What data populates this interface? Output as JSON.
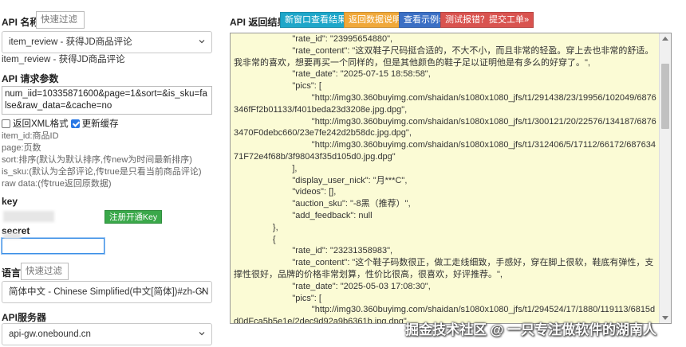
{
  "left": {
    "api_name_label": "API 名称",
    "api_name_filter_placeholder": "快速过滤",
    "api_select_value": "item_review - 获得JD商品评论",
    "api_selected_text": "item_review - 获得JD商品评论",
    "params_label": "API 请求参数",
    "params_value": "num_iid=10335871600&page=1&sort=&is_sku=false&raw_data=&cache=no",
    "check_xml_label": "返回XML格式",
    "check_xml_checked": false,
    "check_cache_label": "更新缓存",
    "check_cache_checked": true,
    "help_lines": [
      "item_id:商品ID",
      "page:页数",
      "sort:排序(默认为默认排序,传new为时间最新排序)",
      "is_sku:(默认为全部评论,传true是只看当前商品评论)",
      "raw data:(传true返回原数据)"
    ],
    "key_label": "key",
    "register_button": "注册开通Key",
    "secret_label": "secret",
    "lang_label": "语言",
    "lang_filter_placeholder": "快速过滤",
    "lang_select_value": "简体中文 - Chinese Simplified(中文[简体])#zh-CN",
    "server_label": "API服务器",
    "server_select_value": "api-gw.onebound.cn"
  },
  "right": {
    "title": "API 返回结果",
    "buttons": {
      "new_window": "新窗口查看结果»",
      "return_desc": "返回数据说明»",
      "example": "查看示例»",
      "report": "测试报错？提交工单»"
    },
    "colors": {
      "new_window": "#1ea6c9",
      "return_desc": "#f0a83a",
      "example": "#3b6fc4",
      "report": "#d9534f",
      "result_bg": "#fbfbd5"
    },
    "result_lines": [
      "                        \"rate_id\": \"23995654880\",",
      "                        \"rate_content\": \"这双鞋子尺码挺合适的，不大不小，而且非常的轻盈。穿上去也非常的舒适。我非常的喜欢，想要再买一个同样的，但是其他颜色的鞋子足以证明他是有多么的好穿了。\",",
      "                        \"rate_date\": \"2025-07-15 18:58:58\",",
      "                        \"pics\": [",
      "                                \"http://img30.360buyimg.com/shaidan/s1080x1080_jfs/t1/291438/23/19956/102049/6876346fFf2b01133/f401beda23d3208e.jpg.dpg\",",
      "                                \"http://img30.360buyimg.com/shaidan/s1080x1080_jfs/t1/300121/20/22576/134187/68763470F0debc660/23e7fe242d2b58dc.jpg.dpg\",",
      "                                \"http://img30.360buyimg.com/shaidan/s1080x1080_jfs/t1/312406/5/17112/66172/68763471F72e4f68b/3f98043f35d105d0.jpg.dpg\"",
      "                        ],",
      "                        \"display_user_nick\": \"月***C\",",
      "                        \"videos\": [],",
      "                        \"auction_sku\": \"-8黑（推荐）\",",
      "                        \"add_feedback\": null",
      "                },",
      "                {",
      "                        \"rate_id\": \"23231358983\",",
      "                        \"rate_content\": \"这个鞋子码数很正，做工走线细致，手感好，穿在脚上很软，鞋底有弹性，支撑性很好，品牌的价格非常划算，性价比很高，很喜欢，好评推荐。\",",
      "                        \"rate_date\": \"2025-05-03 17:08:30\",",
      "                        \"pics\": [",
      "                                \"http://img30.360buyimg.com/shaidan/s1080x1080_jfs/t1/294524/17/1880/119113/6815dd0dFca5b5e1e/2dec9d92a9b6361b.jpg.dpg\","
    ],
    "watermark": "掘金技术社区 @ 一只专注做软件的湖南人"
  }
}
